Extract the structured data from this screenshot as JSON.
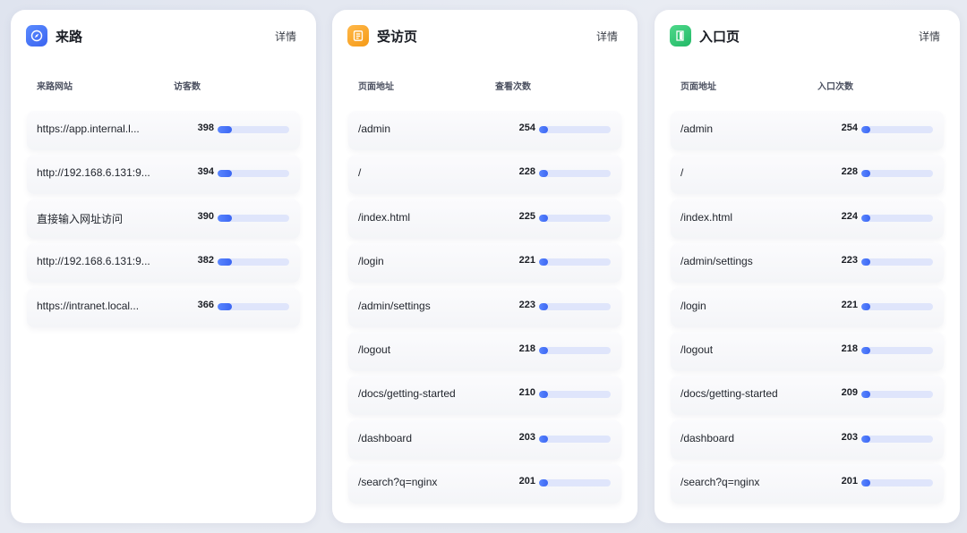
{
  "panels": [
    {
      "title": "来路",
      "icon": "compass-icon",
      "accent": "#3a63f0",
      "detail": "详情",
      "col1": "来路网站",
      "col2": "访客数",
      "rows": [
        {
          "name": "https://app.internal.l...",
          "value": "398",
          "ratio": 0.2
        },
        {
          "name": "http://192.168.6.131:9...",
          "value": "394",
          "ratio": 0.2
        },
        {
          "name": "直接输入网址访问",
          "value": "390",
          "ratio": 0.2
        },
        {
          "name": "http://192.168.6.131:9...",
          "value": "382",
          "ratio": 0.2
        },
        {
          "name": "https://intranet.local...",
          "value": "366",
          "ratio": 0.2
        }
      ]
    },
    {
      "title": "受访页",
      "icon": "page-icon",
      "accent": "#f59a16",
      "detail": "详情",
      "col1": "页面地址",
      "col2": "查看次数",
      "rows": [
        {
          "name": "/admin",
          "value": "254",
          "ratio": 0.12
        },
        {
          "name": "/",
          "value": "228",
          "ratio": 0.12
        },
        {
          "name": "/index.html",
          "value": "225",
          "ratio": 0.12
        },
        {
          "name": "/login",
          "value": "221",
          "ratio": 0.12
        },
        {
          "name": "/admin/settings",
          "value": "223",
          "ratio": 0.12
        },
        {
          "name": "/logout",
          "value": "218",
          "ratio": 0.12
        },
        {
          "name": "/docs/getting-started",
          "value": "210",
          "ratio": 0.12
        },
        {
          "name": "/dashboard",
          "value": "203",
          "ratio": 0.12
        },
        {
          "name": "/search?q=nginx",
          "value": "201",
          "ratio": 0.12
        }
      ]
    },
    {
      "title": "入口页",
      "icon": "entry-door-icon",
      "accent": "#22b866",
      "detail": "详情",
      "col1": "页面地址",
      "col2": "入口次数",
      "rows": [
        {
          "name": "/admin",
          "value": "254",
          "ratio": 0.12
        },
        {
          "name": "/",
          "value": "228",
          "ratio": 0.12
        },
        {
          "name": "/index.html",
          "value": "224",
          "ratio": 0.12
        },
        {
          "name": "/admin/settings",
          "value": "223",
          "ratio": 0.12
        },
        {
          "name": "/login",
          "value": "221",
          "ratio": 0.12
        },
        {
          "name": "/logout",
          "value": "218",
          "ratio": 0.12
        },
        {
          "name": "/docs/getting-started",
          "value": "209",
          "ratio": 0.12
        },
        {
          "name": "/dashboard",
          "value": "203",
          "ratio": 0.12
        },
        {
          "name": "/search?q=nginx",
          "value": "201",
          "ratio": 0.12
        }
      ]
    }
  ]
}
